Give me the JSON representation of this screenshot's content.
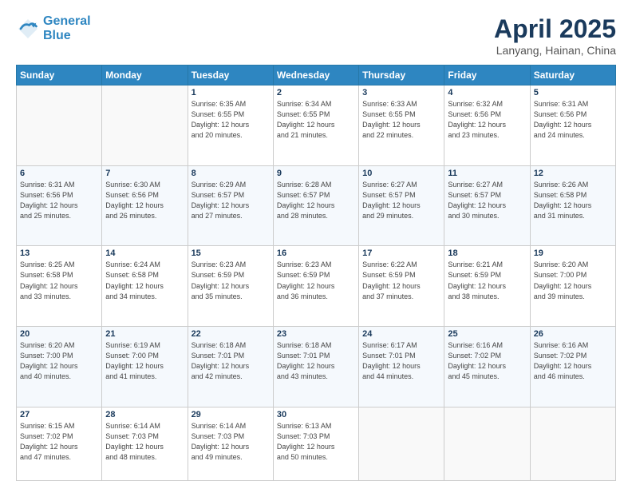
{
  "header": {
    "logo_line1": "General",
    "logo_line2": "Blue",
    "main_title": "April 2025",
    "subtitle": "Lanyang, Hainan, China"
  },
  "days_of_week": [
    "Sunday",
    "Monday",
    "Tuesday",
    "Wednesday",
    "Thursday",
    "Friday",
    "Saturday"
  ],
  "weeks": [
    [
      {
        "day": "",
        "info": ""
      },
      {
        "day": "",
        "info": ""
      },
      {
        "day": "1",
        "info": "Sunrise: 6:35 AM\nSunset: 6:55 PM\nDaylight: 12 hours\nand 20 minutes."
      },
      {
        "day": "2",
        "info": "Sunrise: 6:34 AM\nSunset: 6:55 PM\nDaylight: 12 hours\nand 21 minutes."
      },
      {
        "day": "3",
        "info": "Sunrise: 6:33 AM\nSunset: 6:55 PM\nDaylight: 12 hours\nand 22 minutes."
      },
      {
        "day": "4",
        "info": "Sunrise: 6:32 AM\nSunset: 6:56 PM\nDaylight: 12 hours\nand 23 minutes."
      },
      {
        "day": "5",
        "info": "Sunrise: 6:31 AM\nSunset: 6:56 PM\nDaylight: 12 hours\nand 24 minutes."
      }
    ],
    [
      {
        "day": "6",
        "info": "Sunrise: 6:31 AM\nSunset: 6:56 PM\nDaylight: 12 hours\nand 25 minutes."
      },
      {
        "day": "7",
        "info": "Sunrise: 6:30 AM\nSunset: 6:56 PM\nDaylight: 12 hours\nand 26 minutes."
      },
      {
        "day": "8",
        "info": "Sunrise: 6:29 AM\nSunset: 6:57 PM\nDaylight: 12 hours\nand 27 minutes."
      },
      {
        "day": "9",
        "info": "Sunrise: 6:28 AM\nSunset: 6:57 PM\nDaylight: 12 hours\nand 28 minutes."
      },
      {
        "day": "10",
        "info": "Sunrise: 6:27 AM\nSunset: 6:57 PM\nDaylight: 12 hours\nand 29 minutes."
      },
      {
        "day": "11",
        "info": "Sunrise: 6:27 AM\nSunset: 6:57 PM\nDaylight: 12 hours\nand 30 minutes."
      },
      {
        "day": "12",
        "info": "Sunrise: 6:26 AM\nSunset: 6:58 PM\nDaylight: 12 hours\nand 31 minutes."
      }
    ],
    [
      {
        "day": "13",
        "info": "Sunrise: 6:25 AM\nSunset: 6:58 PM\nDaylight: 12 hours\nand 33 minutes."
      },
      {
        "day": "14",
        "info": "Sunrise: 6:24 AM\nSunset: 6:58 PM\nDaylight: 12 hours\nand 34 minutes."
      },
      {
        "day": "15",
        "info": "Sunrise: 6:23 AM\nSunset: 6:59 PM\nDaylight: 12 hours\nand 35 minutes."
      },
      {
        "day": "16",
        "info": "Sunrise: 6:23 AM\nSunset: 6:59 PM\nDaylight: 12 hours\nand 36 minutes."
      },
      {
        "day": "17",
        "info": "Sunrise: 6:22 AM\nSunset: 6:59 PM\nDaylight: 12 hours\nand 37 minutes."
      },
      {
        "day": "18",
        "info": "Sunrise: 6:21 AM\nSunset: 6:59 PM\nDaylight: 12 hours\nand 38 minutes."
      },
      {
        "day": "19",
        "info": "Sunrise: 6:20 AM\nSunset: 7:00 PM\nDaylight: 12 hours\nand 39 minutes."
      }
    ],
    [
      {
        "day": "20",
        "info": "Sunrise: 6:20 AM\nSunset: 7:00 PM\nDaylight: 12 hours\nand 40 minutes."
      },
      {
        "day": "21",
        "info": "Sunrise: 6:19 AM\nSunset: 7:00 PM\nDaylight: 12 hours\nand 41 minutes."
      },
      {
        "day": "22",
        "info": "Sunrise: 6:18 AM\nSunset: 7:01 PM\nDaylight: 12 hours\nand 42 minutes."
      },
      {
        "day": "23",
        "info": "Sunrise: 6:18 AM\nSunset: 7:01 PM\nDaylight: 12 hours\nand 43 minutes."
      },
      {
        "day": "24",
        "info": "Sunrise: 6:17 AM\nSunset: 7:01 PM\nDaylight: 12 hours\nand 44 minutes."
      },
      {
        "day": "25",
        "info": "Sunrise: 6:16 AM\nSunset: 7:02 PM\nDaylight: 12 hours\nand 45 minutes."
      },
      {
        "day": "26",
        "info": "Sunrise: 6:16 AM\nSunset: 7:02 PM\nDaylight: 12 hours\nand 46 minutes."
      }
    ],
    [
      {
        "day": "27",
        "info": "Sunrise: 6:15 AM\nSunset: 7:02 PM\nDaylight: 12 hours\nand 47 minutes."
      },
      {
        "day": "28",
        "info": "Sunrise: 6:14 AM\nSunset: 7:03 PM\nDaylight: 12 hours\nand 48 minutes."
      },
      {
        "day": "29",
        "info": "Sunrise: 6:14 AM\nSunset: 7:03 PM\nDaylight: 12 hours\nand 49 minutes."
      },
      {
        "day": "30",
        "info": "Sunrise: 6:13 AM\nSunset: 7:03 PM\nDaylight: 12 hours\nand 50 minutes."
      },
      {
        "day": "",
        "info": ""
      },
      {
        "day": "",
        "info": ""
      },
      {
        "day": "",
        "info": ""
      }
    ]
  ]
}
